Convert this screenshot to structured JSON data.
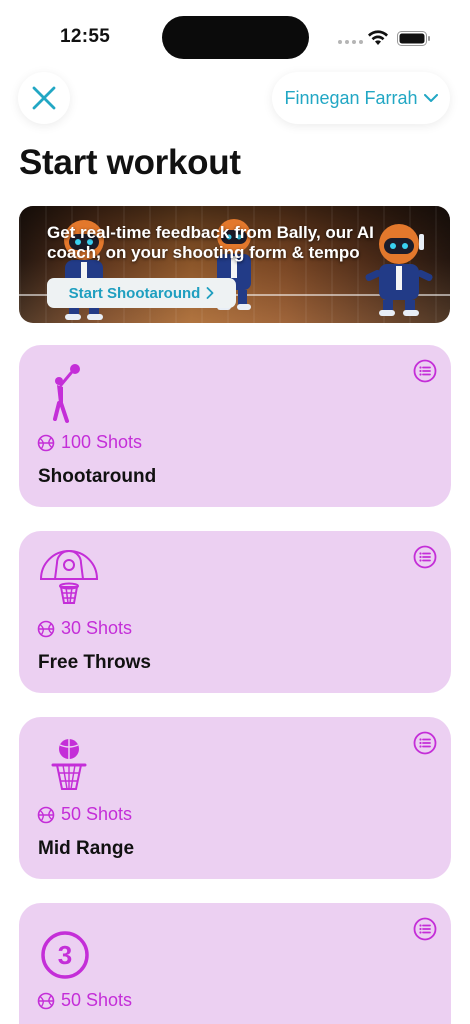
{
  "status_bar": {
    "time": "12:55"
  },
  "header": {
    "close_icon": "close-icon",
    "user_name": "Finnegan Farrah",
    "title": "Start workout"
  },
  "banner": {
    "text": "Get real-time feedback from Bally, our AI coach, on your shooting form & tempo",
    "cta_label": "Start Shootaround"
  },
  "colors": {
    "accent": "#22a7c4",
    "card_bg": "#ecd0f2",
    "card_accent": "#c42ed8"
  },
  "workouts": [
    {
      "icon": "shooter-icon",
      "shots": "100 Shots",
      "title": "Shootaround"
    },
    {
      "icon": "key-hoop-icon",
      "shots": "30 Shots",
      "title": "Free Throws"
    },
    {
      "icon": "ball-hoop-icon",
      "shots": "50 Shots",
      "title": "Mid Range"
    },
    {
      "icon": "three-point-icon",
      "shots": "50 Shots",
      "title": ""
    }
  ]
}
